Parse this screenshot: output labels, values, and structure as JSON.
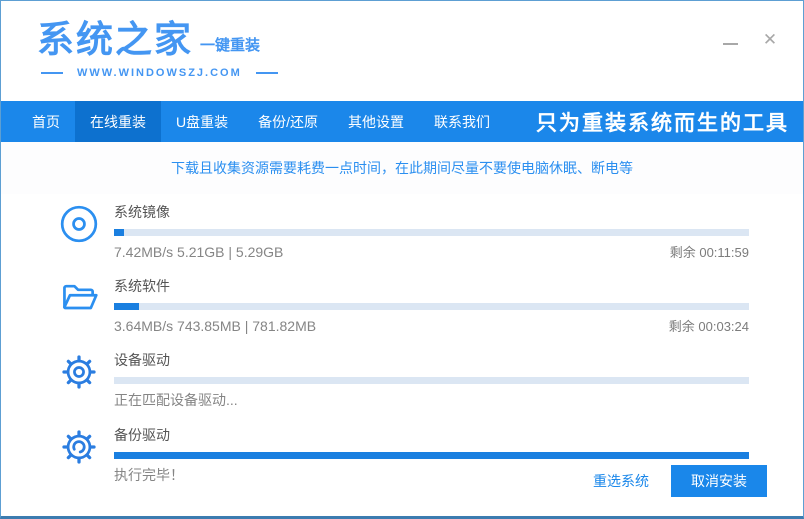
{
  "window": {
    "logo_title": "系统之家",
    "logo_subtitle": "一键重装",
    "website": "WWW.WINDOWSZJ.COM",
    "controls": {
      "minimize_icon": "minimize",
      "close_icon": "✕"
    }
  },
  "nav": {
    "tabs": [
      {
        "label": "首页",
        "active": false
      },
      {
        "label": "在线重装",
        "active": true
      },
      {
        "label": "U盘重装",
        "active": false
      },
      {
        "label": "备份/还原",
        "active": false
      },
      {
        "label": "其他设置",
        "active": false
      },
      {
        "label": "联系我们",
        "active": false
      }
    ],
    "slogan": "只为重装系统而生的工具"
  },
  "notice": "下载且收集资源需要耗费一点时间，在此期间尽量不要使电脑休眠、断电等",
  "tasks": [
    {
      "icon": "disc-icon",
      "title": "系统镜像",
      "progress_percent": 1.6,
      "detail": "7.42MB/s 5.21GB | 5.29GB",
      "remaining": "剩余 00:11:59"
    },
    {
      "icon": "folder-icon",
      "title": "系统软件",
      "progress_percent": 4,
      "detail": "3.64MB/s 743.85MB | 781.82MB",
      "remaining": "剩余 00:03:24"
    },
    {
      "icon": "gear-icon",
      "title": "设备驱动",
      "progress_percent": 0,
      "detail": "正在匹配设备驱动...",
      "remaining": ""
    },
    {
      "icon": "gear-sync-icon",
      "title": "备份驱动",
      "progress_percent": 100,
      "detail": "执行完毕！",
      "remaining": ""
    }
  ],
  "footer": {
    "reselect_label": "重选系统",
    "cancel_label": "取消安装"
  },
  "colors": {
    "nav_blue": "#1b87ea",
    "active_tab_blue": "#0d71cf",
    "logo_blue": "#4496f2",
    "notice_blue": "#2b8ff0",
    "progress_fill": "#1a7fe0",
    "progress_track": "#dbe6f3",
    "button_blue": "#1a87ea",
    "border_blue": "#5d9fd3"
  }
}
